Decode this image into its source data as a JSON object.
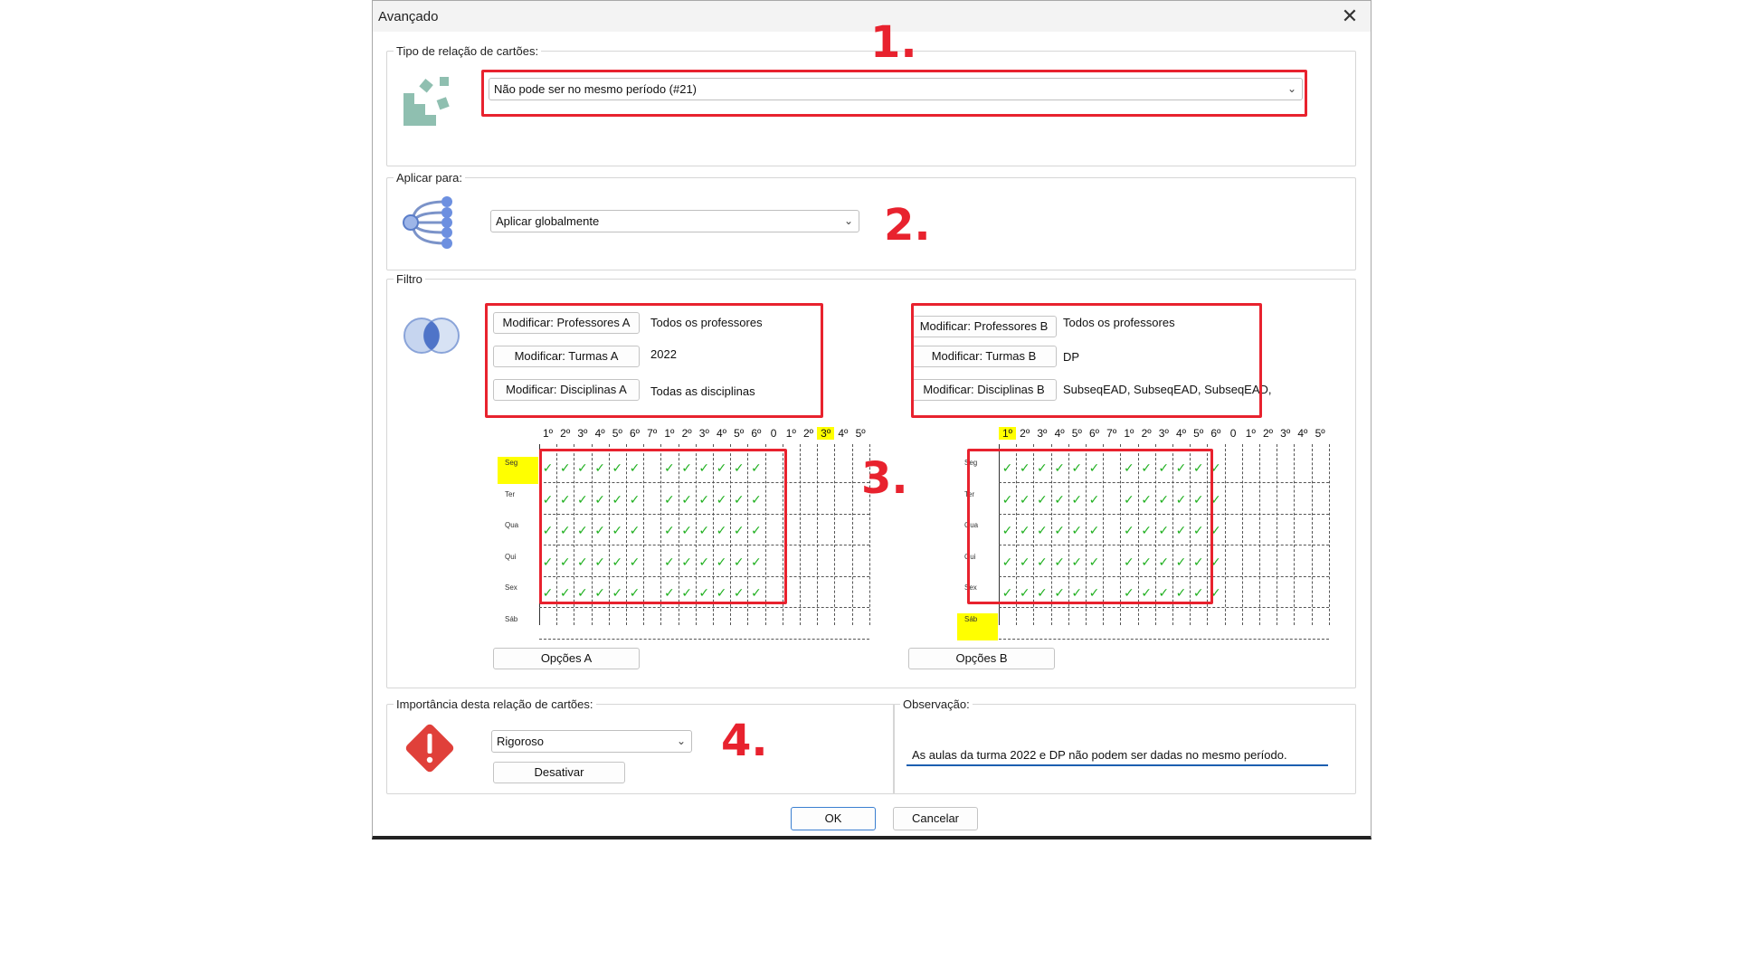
{
  "window": {
    "title": "Avançado",
    "close_glyph": "✕"
  },
  "card_type": {
    "label": "Tipo de relação de cartões:",
    "selected": "Não pode ser no mesmo período (#21)",
    "icon": "cards-shape-icon"
  },
  "apply": {
    "label": "Aplicar para:",
    "selected": "Aplicar globalmente",
    "icon": "tree-nodes-icon"
  },
  "filter": {
    "label": "Filtro",
    "icon": "venn-diagram-icon",
    "a": {
      "teachers_button": "Modificar: Professores A",
      "teachers_value": "Todos os professores",
      "classes_button": "Modificar: Turmas A",
      "classes_value": "2022",
      "subjects_button": "Modificar: Disciplinas A",
      "subjects_value": "Todas as disciplinas",
      "options_button": "Opções A"
    },
    "b": {
      "teachers_button": "Modificar: Professores B",
      "teachers_value": "Todos os professores",
      "classes_button": "Modificar: Turmas B",
      "classes_value": "DP",
      "subjects_button": "Modificar: Disciplinas B",
      "subjects_value": "SubseqEAD, SubseqEAD, SubseqEAD,",
      "options_button": "Opções B"
    },
    "periods": [
      "1º",
      "2º",
      "3º",
      "4º",
      "5º",
      "6º",
      "7º",
      "1º",
      "2º",
      "3º",
      "4º",
      "5º",
      "6º",
      "0",
      "1º",
      "2º",
      "3º",
      "4º",
      "5º"
    ],
    "days": [
      "Seg",
      "Ter",
      "Qua",
      "Qui",
      "Sex",
      "Sáb"
    ],
    "grid_a": {
      "highlight_period": 16,
      "highlight_day": 0,
      "checked_rows": [
        0,
        1,
        2,
        3,
        4
      ],
      "checked_cols": [
        0,
        1,
        2,
        3,
        4,
        5,
        7,
        8,
        9,
        10,
        11,
        12
      ]
    },
    "grid_b": {
      "highlight_period": 0,
      "highlight_day": 5,
      "checked_rows": [
        0,
        1,
        2,
        3,
        4
      ],
      "checked_cols": [
        0,
        1,
        2,
        3,
        4,
        5,
        7,
        8,
        9,
        10,
        11,
        12
      ]
    },
    "check_glyph": "✓"
  },
  "importance": {
    "label": "Importância desta relação de cartões:",
    "selected": "Rigoroso",
    "deactivate_button": "Desativar",
    "icon": "warning-diamond-icon"
  },
  "observation": {
    "label": "Observação:",
    "value": "As aulas da turma 2022 e DP não podem ser dadas no mesmo período."
  },
  "footer": {
    "ok": "OK",
    "cancel": "Cancelar"
  },
  "annotations": {
    "one": "1.",
    "two": "2.",
    "three": "3.",
    "four": "4."
  },
  "colors": {
    "annotation_red": "#e8222e",
    "check_green": "#20b020",
    "highlight_yellow": "#ffff00",
    "warning_red": "#e0403a",
    "focus_blue": "#1c5fb0"
  }
}
